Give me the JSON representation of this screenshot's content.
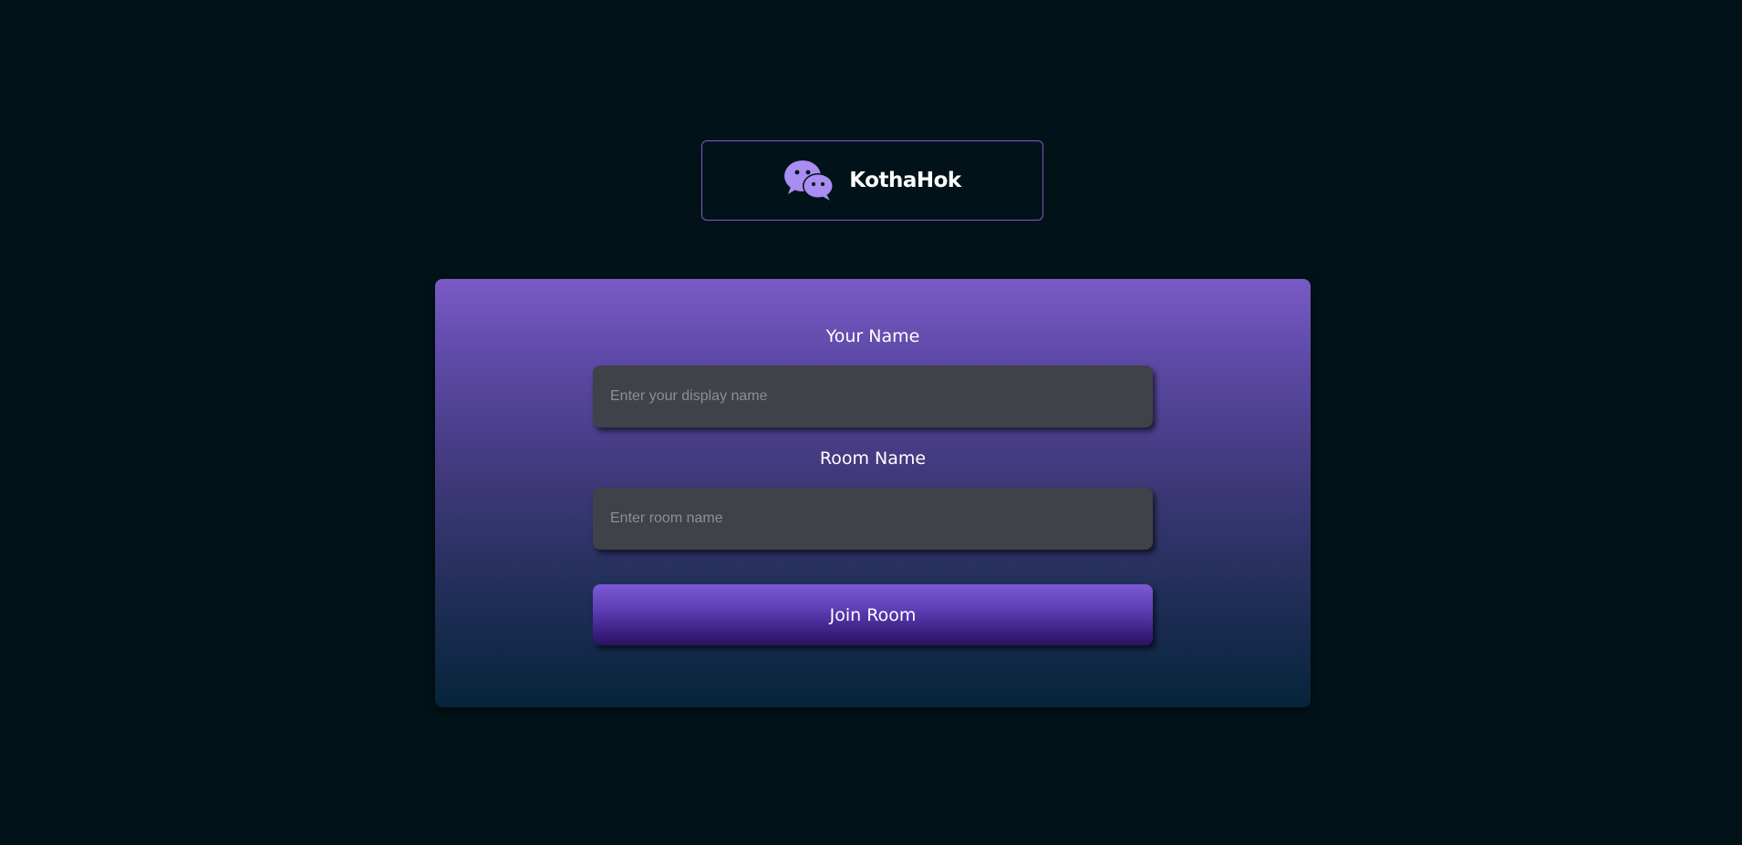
{
  "brand": {
    "name": "KothaHok",
    "icon": "chat-bubbles-icon",
    "accent_color": "#a98df0"
  },
  "form": {
    "name_label": "Your Name",
    "name_placeholder": "Enter your display name",
    "name_value": "",
    "room_label": "Room Name",
    "room_placeholder": "Enter room name",
    "room_value": "",
    "join_label": "Join Room"
  },
  "colors": {
    "background": "#011318",
    "card_top": "#7a5ac6",
    "card_bottom": "#06243a",
    "input_bg": "#3f4248",
    "button_top": "#7c5ad6",
    "button_bottom": "#2a1460"
  }
}
